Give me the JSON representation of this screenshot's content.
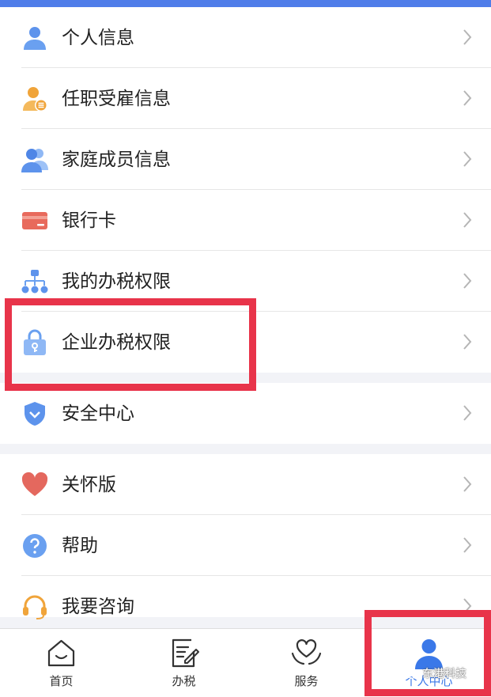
{
  "menu": {
    "group1": [
      {
        "label": "个人信息",
        "icon": "person-icon"
      },
      {
        "label": "任职受雇信息",
        "icon": "employee-icon"
      },
      {
        "label": "家庭成员信息",
        "icon": "family-icon"
      },
      {
        "label": "银行卡",
        "icon": "bank-card-icon"
      },
      {
        "label": "我的办税权限",
        "icon": "org-chart-icon"
      },
      {
        "label": "企业办税权限",
        "icon": "lock-key-icon"
      }
    ],
    "group2": [
      {
        "label": "安全中心",
        "icon": "shield-icon"
      }
    ],
    "group3": [
      {
        "label": "关怀版",
        "icon": "heart-icon"
      },
      {
        "label": "帮助",
        "icon": "help-icon"
      },
      {
        "label": "我要咨询",
        "icon": "headset-icon"
      }
    ]
  },
  "tabbar": {
    "home": "首页",
    "tax": "办税",
    "service": "服务",
    "personal": "个人中心"
  },
  "watermark": "东港科技",
  "colors": {
    "accent": "#3a78e8",
    "highlight_box": "#e8344a",
    "topbar": "#4f7de9"
  }
}
